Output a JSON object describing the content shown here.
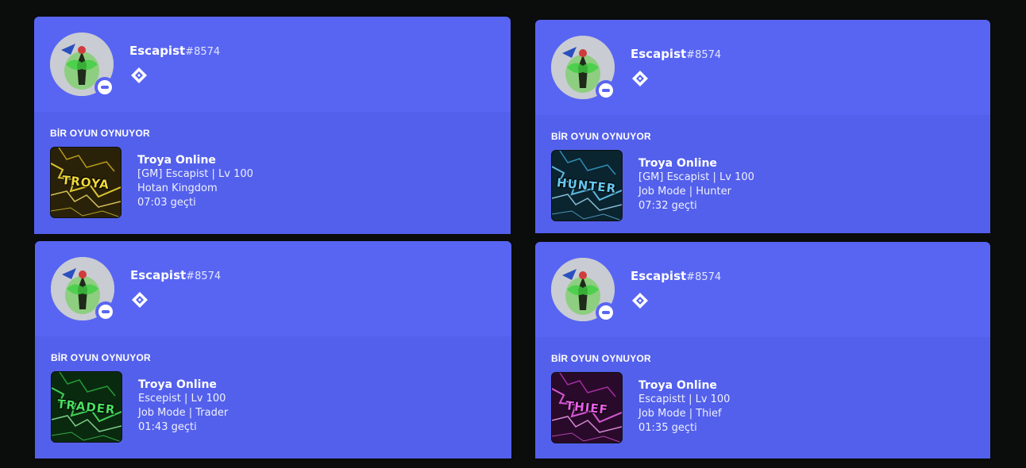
{
  "cards": [
    {
      "username": "Escapist",
      "discriminator": "#8574",
      "status_icon": "dnd-status-icon",
      "badge_icon": "hypesquad-badge-icon",
      "section_title": "BİR OYUN OYNUYOR",
      "game": {
        "art_text": "TROYA",
        "art_color": "#f0d838",
        "art_bg": "#2a2208",
        "name": "Troya Online",
        "line1": "[GM] Escapist | Lv 100",
        "line2": "Hotan Kingdom",
        "elapsed": "07:03 geçti"
      }
    },
    {
      "username": "Escapist",
      "discriminator": "#8574",
      "status_icon": "dnd-status-icon",
      "badge_icon": "hypesquad-badge-icon",
      "section_title": "BİR OYUN OYNUYOR",
      "game": {
        "art_text": "HUNTER",
        "art_color": "#66c8f0",
        "art_bg": "#0a2430",
        "name": "Troya Online",
        "line1": "[GM] Escapist | Lv 100",
        "line2": "Job Mode | Hunter",
        "elapsed": "07:32 geçti"
      }
    },
    {
      "username": "Escapist",
      "discriminator": "#8574",
      "status_icon": "dnd-status-icon",
      "badge_icon": "hypesquad-badge-icon",
      "section_title": "BİR OYUN OYNUYOR",
      "game": {
        "art_text": "TRADER",
        "art_color": "#48e060",
        "art_bg": "#0a2a10",
        "name": "Troya Online",
        "line1": "Escepist | Lv 100",
        "line2": "Job Mode | Trader",
        "elapsed": "01:43 geçti"
      }
    },
    {
      "username": "Escapist",
      "discriminator": "#8574",
      "status_icon": "dnd-status-icon",
      "badge_icon": "hypesquad-badge-icon",
      "section_title": "BİR OYUN OYNUYOR",
      "game": {
        "art_text": "THIEF",
        "art_color": "#e860e8",
        "art_bg": "#2a0a2a",
        "name": "Troya Online",
        "line1": "Escapistt | Lv 100",
        "line2": "Job Mode | Thief",
        "elapsed": "01:35 geçti"
      }
    }
  ],
  "colors": {
    "card_bg": "#5865f2",
    "card_bottom_bg": "#5360eb",
    "page_bg": "#0b0c0c"
  }
}
